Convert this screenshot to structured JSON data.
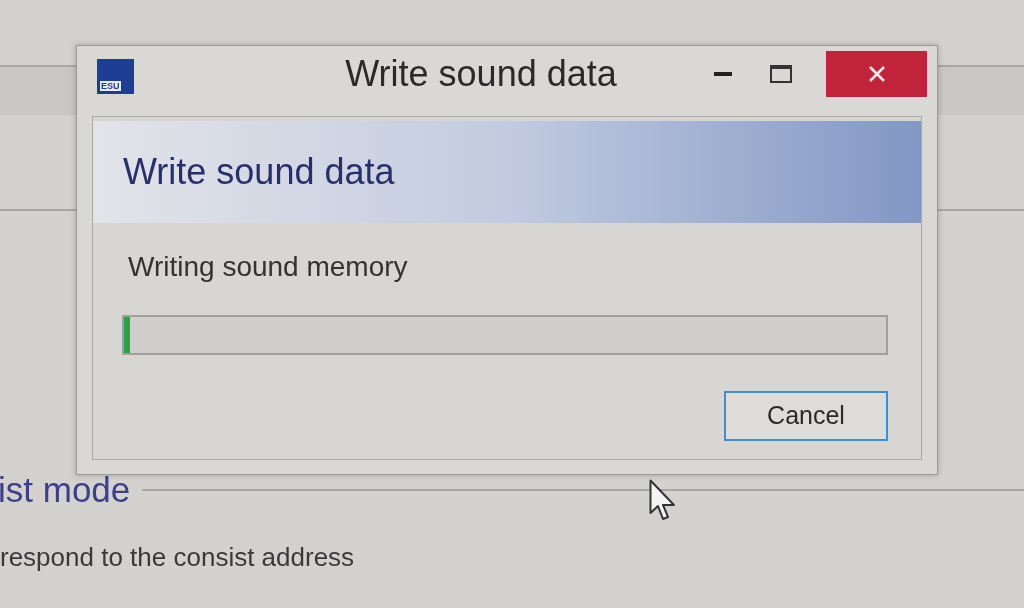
{
  "background_app": {
    "section_heading": "ist mode",
    "description": "respond to the consist address"
  },
  "dialog": {
    "logo_text": "ESU",
    "title": "Write sound data",
    "header": "Write sound data",
    "status": "Writing sound memory",
    "progress": {
      "level": 0.008
    },
    "cancel_button": {
      "label": "Cancel"
    }
  }
}
